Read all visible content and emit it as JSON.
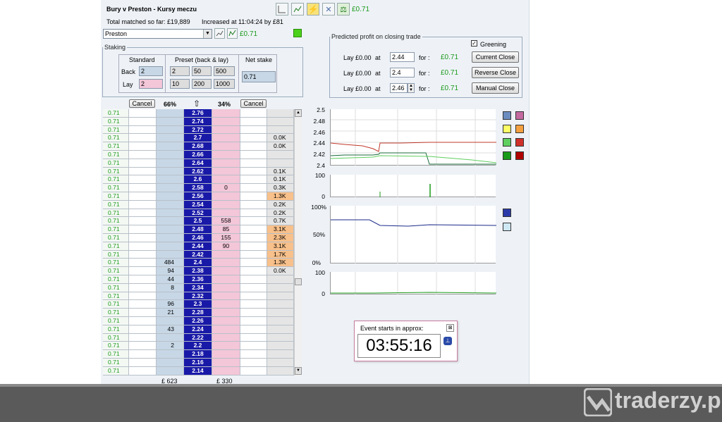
{
  "header": {
    "title": "Bury v Preston - Kursy meczu",
    "matched_label": "Total matched so far: £19,889",
    "increased_label": "Increased at 11:04:24 by £81",
    "top_profit": "£0.71"
  },
  "selection": {
    "value": "Preston",
    "profit": "£0.71"
  },
  "staking": {
    "legend": "Staking",
    "standard": "Standard",
    "preset": "Preset (back & lay)",
    "net_stake": "Net stake",
    "back_label": "Back",
    "lay_label": "Lay",
    "back_value": "2",
    "lay_value": "2",
    "preset_back": [
      "2",
      "50",
      "500"
    ],
    "preset_lay": [
      "10",
      "200",
      "1000"
    ],
    "net_value": "0.71"
  },
  "predicted": {
    "legend": "Predicted profit on closing trade",
    "greening": "Greening",
    "rows": [
      {
        "text": "Lay £0.00",
        "at": "at",
        "odds": "2.44",
        "for": "for :",
        "profit": "£0.71",
        "button": "Current Close"
      },
      {
        "text": "Lay £0.00",
        "at": "at",
        "odds": "2.4",
        "for": "for :",
        "profit": "£0.71",
        "button": "Reverse Close"
      },
      {
        "text": "Lay £0.00",
        "at": "at",
        "odds": "2.46",
        "for": "for :",
        "profit": "£0.71",
        "button": "Manual Close"
      }
    ]
  },
  "ladder": {
    "cancel_left": "Cancel",
    "cancel_right": "Cancel",
    "back_pct": "66%",
    "lay_pct": "34%",
    "up_arrow": "⇧",
    "footer_back": "£ 623",
    "footer_lay": "£ 330",
    "rows": [
      {
        "pl": "0.71",
        "back": "",
        "price": "2.76",
        "lay": "",
        "vol": ""
      },
      {
        "pl": "0.71",
        "back": "",
        "price": "2.74",
        "lay": "",
        "vol": ""
      },
      {
        "pl": "0.71",
        "back": "",
        "price": "2.72",
        "lay": "",
        "vol": ""
      },
      {
        "pl": "0.71",
        "back": "",
        "price": "2.7",
        "lay": "",
        "vol": "0.0K"
      },
      {
        "pl": "0.71",
        "back": "",
        "price": "2.68",
        "lay": "",
        "vol": "0.0K"
      },
      {
        "pl": "0.71",
        "back": "",
        "price": "2.66",
        "lay": "",
        "vol": ""
      },
      {
        "pl": "0.71",
        "back": "",
        "price": "2.64",
        "lay": "",
        "vol": ""
      },
      {
        "pl": "0.71",
        "back": "",
        "price": "2.62",
        "lay": "",
        "vol": "0.1K"
      },
      {
        "pl": "0.71",
        "back": "",
        "price": "2.6",
        "lay": "",
        "vol": "0.1K"
      },
      {
        "pl": "0.71",
        "back": "",
        "price": "2.58",
        "lay": "0",
        "vol": "0.3K"
      },
      {
        "pl": "0.71",
        "back": "",
        "price": "2.56",
        "lay": "",
        "vol": "1.3K",
        "hl": true
      },
      {
        "pl": "0.71",
        "back": "",
        "price": "2.54",
        "lay": "",
        "vol": "0.2K"
      },
      {
        "pl": "0.71",
        "back": "",
        "price": "2.52",
        "lay": "",
        "vol": "0.2K"
      },
      {
        "pl": "0.71",
        "back": "",
        "price": "2.5",
        "lay": "558",
        "vol": "0.7K"
      },
      {
        "pl": "0.71",
        "back": "",
        "price": "2.48",
        "lay": "85",
        "vol": "3.1K",
        "hl": true
      },
      {
        "pl": "0.71",
        "back": "",
        "price": "2.46",
        "lay": "155",
        "vol": "2.3K",
        "hl": true
      },
      {
        "pl": "0.71",
        "back": "",
        "price": "2.44",
        "lay": "90",
        "vol": "3.1K",
        "hl": true
      },
      {
        "pl": "0.71",
        "back": "",
        "price": "2.42",
        "lay": "",
        "vol": "1.7K",
        "hl": true
      },
      {
        "pl": "0.71",
        "back": "484",
        "price": "2.4",
        "lay": "",
        "vol": "1.3K",
        "hl": true
      },
      {
        "pl": "0.71",
        "back": "94",
        "price": "2.38",
        "lay": "",
        "vol": "0.0K"
      },
      {
        "pl": "0.71",
        "back": "44",
        "price": "2.36",
        "lay": "",
        "vol": ""
      },
      {
        "pl": "0.71",
        "back": "8",
        "price": "2.34",
        "lay": "",
        "vol": ""
      },
      {
        "pl": "0.71",
        "back": "",
        "price": "2.32",
        "lay": "",
        "vol": ""
      },
      {
        "pl": "0.71",
        "back": "96",
        "price": "2.3",
        "lay": "",
        "vol": ""
      },
      {
        "pl": "0.71",
        "back": "21",
        "price": "2.28",
        "lay": "",
        "vol": ""
      },
      {
        "pl": "0.71",
        "back": "",
        "price": "2.26",
        "lay": "",
        "vol": ""
      },
      {
        "pl": "0.71",
        "back": "43",
        "price": "2.24",
        "lay": "",
        "vol": ""
      },
      {
        "pl": "0.71",
        "back": "",
        "price": "2.22",
        "lay": "",
        "vol": ""
      },
      {
        "pl": "0.71",
        "back": "2",
        "price": "2.2",
        "lay": "",
        "vol": ""
      },
      {
        "pl": "0.71",
        "back": "",
        "price": "2.18",
        "lay": "",
        "vol": ""
      },
      {
        "pl": "0.71",
        "back": "",
        "price": "2.16",
        "lay": "",
        "vol": ""
      },
      {
        "pl": "0.71",
        "back": "",
        "price": "2.14",
        "lay": "",
        "vol": ""
      }
    ]
  },
  "charts": {
    "price_axis": [
      "2.5",
      "2.48",
      "2.46",
      "2.44",
      "2.42",
      "2.4"
    ],
    "vol1_axis": [
      "100",
      "0"
    ],
    "pct_axis": [
      "100%",
      "50%",
      "0%"
    ],
    "vol2_axis": [
      "100",
      "0"
    ]
  },
  "timer": {
    "label": "Event starts in approx:",
    "value": "03:55:16"
  },
  "watermark": "traderzy.pl",
  "colors": {
    "back": "#c7d7e6",
    "lay": "#f3c6d8",
    "price": "#1919a8",
    "profit": "#1b9a1b",
    "highlight": "#f8c08a"
  }
}
